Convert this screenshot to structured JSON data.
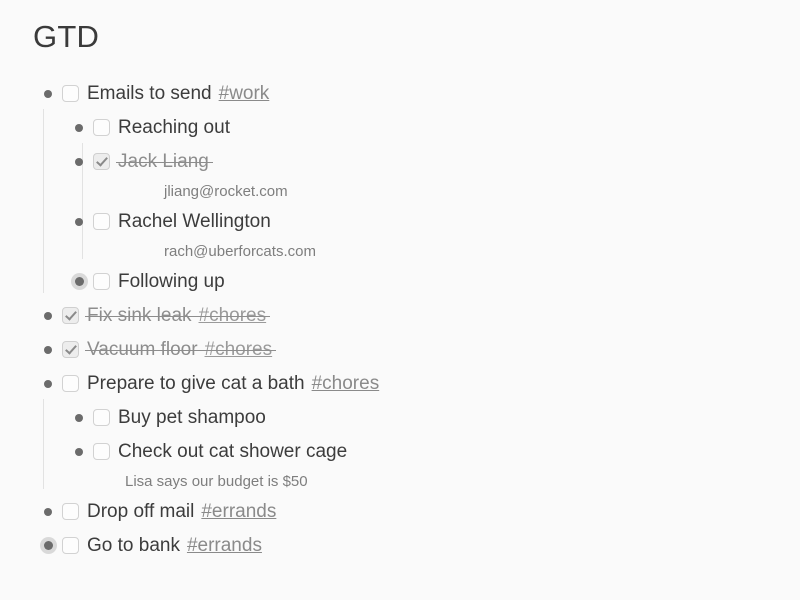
{
  "page": {
    "title": "GTD",
    "background": "#fafafa",
    "text_color": "#3c3c3c",
    "muted_color": "#8d8d8d",
    "tag_color": "#8a8a8a",
    "bullet_color": "#6b6b6b",
    "guide_color": "#e2e2e2"
  },
  "outline": {
    "items": [
      {
        "id": "emails-to-send",
        "text": "Emails to send",
        "tag": "#work",
        "checked": false,
        "collapsed": false,
        "note": "",
        "children": [
          {
            "id": "reaching-out",
            "text": "Reaching out",
            "tag": "",
            "checked": false,
            "collapsed": false,
            "note": "",
            "children": [
              {
                "id": "jack-liang",
                "text": "Jack Liang",
                "tag": "",
                "checked": true,
                "collapsed": false,
                "note": "jliang@rocket.com",
                "children": []
              },
              {
                "id": "rachel-wellington",
                "text": "Rachel Wellington",
                "tag": "",
                "checked": false,
                "collapsed": false,
                "note": "rach@uberforcats.com",
                "children": []
              }
            ]
          },
          {
            "id": "following-up",
            "text": "Following up",
            "tag": "",
            "checked": false,
            "collapsed": true,
            "note": "",
            "children": []
          }
        ]
      },
      {
        "id": "fix-sink-leak",
        "text": "Fix sink leak",
        "tag": "#chores",
        "checked": true,
        "collapsed": false,
        "note": "",
        "children": []
      },
      {
        "id": "vacuum-floor",
        "text": "Vacuum floor",
        "tag": "#chores",
        "checked": true,
        "collapsed": false,
        "note": "",
        "children": []
      },
      {
        "id": "prepare-cat-bath",
        "text": "Prepare to give cat a bath",
        "tag": "#chores",
        "checked": false,
        "collapsed": false,
        "note": "",
        "children": [
          {
            "id": "buy-pet-shampoo",
            "text": "Buy pet shampoo",
            "tag": "",
            "checked": false,
            "collapsed": false,
            "note": "",
            "children": []
          },
          {
            "id": "check-cat-shower-cage",
            "text": "Check out cat shower cage",
            "tag": "",
            "checked": false,
            "collapsed": false,
            "note": "Lisa says our budget is $50",
            "children": []
          }
        ]
      },
      {
        "id": "drop-off-mail",
        "text": "Drop off mail",
        "tag": "#errands",
        "checked": false,
        "collapsed": false,
        "note": "",
        "children": []
      },
      {
        "id": "go-to-bank",
        "text": "Go to bank",
        "tag": "#errands",
        "checked": false,
        "collapsed": true,
        "note": "",
        "children": []
      }
    ]
  }
}
